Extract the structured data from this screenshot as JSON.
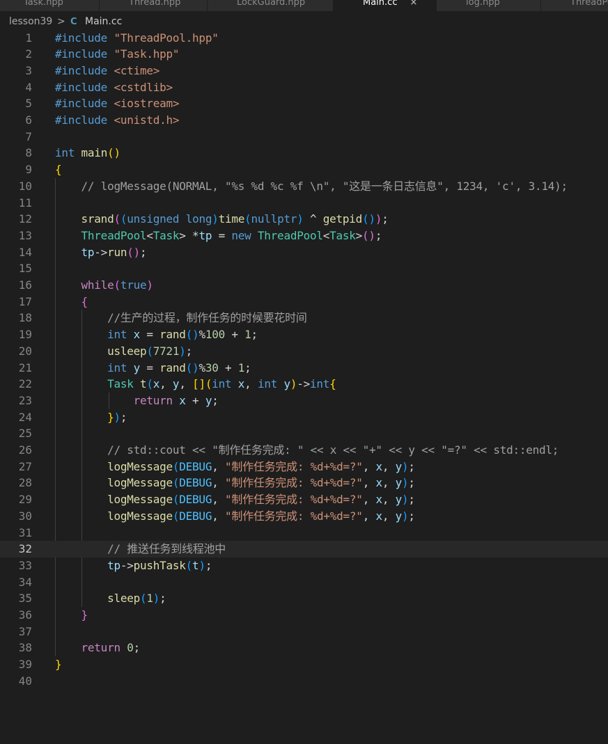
{
  "tabs": [
    {
      "label": "Task.hpp",
      "active": false
    },
    {
      "label": "Thread.hpp",
      "active": false
    },
    {
      "label": "LockGuard.hpp",
      "active": false
    },
    {
      "label": "Main.cc",
      "active": true
    },
    {
      "label": "log.hpp",
      "active": false
    },
    {
      "label": "ThreadPool.hpp",
      "active": false
    }
  ],
  "breadcrumb": {
    "folder": "lesson39",
    "separator": ">",
    "file_icon": "C",
    "file": "Main.cc"
  },
  "editor": {
    "current_line": 32,
    "lines": [
      {
        "n": "1",
        "tokens": [
          [
            "#include",
            "kw"
          ],
          [
            " ",
            "plain"
          ],
          [
            "\"ThreadPool.hpp\"",
            "str"
          ]
        ]
      },
      {
        "n": "2",
        "tokens": [
          [
            "#include",
            "kw"
          ],
          [
            " ",
            "plain"
          ],
          [
            "\"Task.hpp\"",
            "str"
          ]
        ]
      },
      {
        "n": "3",
        "tokens": [
          [
            "#include",
            "kw"
          ],
          [
            " ",
            "plain"
          ],
          [
            "<ctime>",
            "str"
          ]
        ]
      },
      {
        "n": "4",
        "tokens": [
          [
            "#include",
            "kw"
          ],
          [
            " ",
            "plain"
          ],
          [
            "<cstdlib>",
            "str"
          ]
        ]
      },
      {
        "n": "5",
        "tokens": [
          [
            "#include",
            "kw"
          ],
          [
            " ",
            "plain"
          ],
          [
            "<iostream>",
            "str"
          ]
        ]
      },
      {
        "n": "6",
        "tokens": [
          [
            "#include",
            "kw"
          ],
          [
            " ",
            "plain"
          ],
          [
            "<unistd.h>",
            "str"
          ]
        ]
      },
      {
        "n": "7",
        "tokens": []
      },
      {
        "n": "8",
        "tokens": [
          [
            "int",
            "kw"
          ],
          [
            " ",
            "plain"
          ],
          [
            "main",
            "fn"
          ],
          [
            "()",
            "b1"
          ]
        ]
      },
      {
        "n": "9",
        "tokens": [
          [
            "{",
            "b1"
          ]
        ]
      },
      {
        "n": "10",
        "tokens": [
          [
            "    ",
            "plain"
          ],
          [
            "// logMessage(NORMAL, \"%s %d %c %f \\n\", \"这是一条日志信息\", 1234, 'c', 3.14);",
            "cmt-gray"
          ]
        ]
      },
      {
        "n": "11",
        "tokens": []
      },
      {
        "n": "12",
        "tokens": [
          [
            "    ",
            "plain"
          ],
          [
            "srand",
            "fn"
          ],
          [
            "(",
            "b2"
          ],
          [
            "(",
            "b3"
          ],
          [
            "unsigned",
            "kw"
          ],
          [
            " ",
            "plain"
          ],
          [
            "long",
            "kw"
          ],
          [
            ")",
            "b3"
          ],
          [
            "time",
            "fn"
          ],
          [
            "(",
            "b3"
          ],
          [
            "nullptr",
            "kw"
          ],
          [
            ")",
            "b3"
          ],
          [
            " ^ ",
            "plain"
          ],
          [
            "getpid",
            "fn"
          ],
          [
            "()",
            "b3"
          ],
          [
            ")",
            "b2"
          ],
          [
            ";",
            "plain"
          ]
        ]
      },
      {
        "n": "13",
        "tokens": [
          [
            "    ",
            "plain"
          ],
          [
            "ThreadPool",
            "type"
          ],
          [
            "<",
            "plain"
          ],
          [
            "Task",
            "type"
          ],
          [
            "> *",
            "plain"
          ],
          [
            "tp",
            "var"
          ],
          [
            " = ",
            "plain"
          ],
          [
            "new",
            "kw"
          ],
          [
            " ",
            "plain"
          ],
          [
            "ThreadPool",
            "type"
          ],
          [
            "<",
            "plain"
          ],
          [
            "Task",
            "type"
          ],
          [
            ">",
            "plain"
          ],
          [
            "()",
            "b2"
          ],
          [
            ";",
            "plain"
          ]
        ]
      },
      {
        "n": "14",
        "tokens": [
          [
            "    ",
            "plain"
          ],
          [
            "tp",
            "var"
          ],
          [
            "->",
            "plain"
          ],
          [
            "run",
            "fn"
          ],
          [
            "()",
            "b2"
          ],
          [
            ";",
            "plain"
          ]
        ]
      },
      {
        "n": "15",
        "tokens": []
      },
      {
        "n": "16",
        "tokens": [
          [
            "    ",
            "plain"
          ],
          [
            "while",
            "ctrl"
          ],
          [
            "(",
            "b2"
          ],
          [
            "true",
            "kw"
          ],
          [
            ")",
            "b2"
          ]
        ]
      },
      {
        "n": "17",
        "tokens": [
          [
            "    ",
            "plain"
          ],
          [
            "{",
            "b2"
          ]
        ]
      },
      {
        "n": "18",
        "tokens": [
          [
            "        ",
            "plain"
          ],
          [
            "//生产的过程，制作任务的时候要花时间",
            "cmt-gray"
          ]
        ]
      },
      {
        "n": "19",
        "tokens": [
          [
            "        ",
            "plain"
          ],
          [
            "int",
            "kw"
          ],
          [
            " ",
            "plain"
          ],
          [
            "x",
            "var"
          ],
          [
            " = ",
            "plain"
          ],
          [
            "rand",
            "fn"
          ],
          [
            "()",
            "b3"
          ],
          [
            "%",
            "plain"
          ],
          [
            "100",
            "num"
          ],
          [
            " + ",
            "plain"
          ],
          [
            "1",
            "num"
          ],
          [
            ";",
            "plain"
          ]
        ]
      },
      {
        "n": "20",
        "tokens": [
          [
            "        ",
            "plain"
          ],
          [
            "usleep",
            "fn"
          ],
          [
            "(",
            "b3"
          ],
          [
            "7721",
            "num"
          ],
          [
            ")",
            "b3"
          ],
          [
            ";",
            "plain"
          ]
        ]
      },
      {
        "n": "21",
        "tokens": [
          [
            "        ",
            "plain"
          ],
          [
            "int",
            "kw"
          ],
          [
            " ",
            "plain"
          ],
          [
            "y",
            "var"
          ],
          [
            " = ",
            "plain"
          ],
          [
            "rand",
            "fn"
          ],
          [
            "()",
            "b3"
          ],
          [
            "%",
            "plain"
          ],
          [
            "30",
            "num"
          ],
          [
            " + ",
            "plain"
          ],
          [
            "1",
            "num"
          ],
          [
            ";",
            "plain"
          ]
        ]
      },
      {
        "n": "22",
        "tokens": [
          [
            "        ",
            "plain"
          ],
          [
            "Task",
            "type"
          ],
          [
            " ",
            "plain"
          ],
          [
            "t",
            "fn"
          ],
          [
            "(",
            "b3"
          ],
          [
            "x",
            "var"
          ],
          [
            ", ",
            "plain"
          ],
          [
            "y",
            "var"
          ],
          [
            ", ",
            "plain"
          ],
          [
            "[]",
            "b1"
          ],
          [
            "(",
            "b1"
          ],
          [
            "int",
            "kw"
          ],
          [
            " ",
            "plain"
          ],
          [
            "x",
            "var"
          ],
          [
            ", ",
            "plain"
          ],
          [
            "int",
            "kw"
          ],
          [
            " ",
            "plain"
          ],
          [
            "y",
            "var"
          ],
          [
            ")",
            "b1"
          ],
          [
            "->",
            "plain"
          ],
          [
            "int",
            "kw"
          ],
          [
            "{",
            "b1"
          ]
        ]
      },
      {
        "n": "23",
        "tokens": [
          [
            "            ",
            "plain"
          ],
          [
            "return",
            "ctrl"
          ],
          [
            " ",
            "plain"
          ],
          [
            "x",
            "var"
          ],
          [
            " + ",
            "plain"
          ],
          [
            "y",
            "var"
          ],
          [
            ";",
            "plain"
          ]
        ]
      },
      {
        "n": "24",
        "tokens": [
          [
            "        ",
            "plain"
          ],
          [
            "}",
            "b1"
          ],
          [
            ")",
            "b3"
          ],
          [
            ";",
            "plain"
          ]
        ]
      },
      {
        "n": "25",
        "tokens": []
      },
      {
        "n": "26",
        "tokens": [
          [
            "        ",
            "plain"
          ],
          [
            "// std::cout << \"制作任务完成: \" << x << \"+\" << y << \"=?\" << std::endl;",
            "cmt-gray"
          ]
        ]
      },
      {
        "n": "27",
        "tokens": [
          [
            "        ",
            "plain"
          ],
          [
            "logMessage",
            "fn"
          ],
          [
            "(",
            "b3"
          ],
          [
            "DEBUG",
            "enum"
          ],
          [
            ", ",
            "plain"
          ],
          [
            "\"制作任务完成: %d+%d=?\"",
            "str"
          ],
          [
            ", ",
            "plain"
          ],
          [
            "x",
            "var"
          ],
          [
            ", ",
            "plain"
          ],
          [
            "y",
            "var"
          ],
          [
            ")",
            "b3"
          ],
          [
            ";",
            "plain"
          ]
        ]
      },
      {
        "n": "28",
        "tokens": [
          [
            "        ",
            "plain"
          ],
          [
            "logMessage",
            "fn"
          ],
          [
            "(",
            "b3"
          ],
          [
            "DEBUG",
            "enum"
          ],
          [
            ", ",
            "plain"
          ],
          [
            "\"制作任务完成: %d+%d=?\"",
            "str"
          ],
          [
            ", ",
            "plain"
          ],
          [
            "x",
            "var"
          ],
          [
            ", ",
            "plain"
          ],
          [
            "y",
            "var"
          ],
          [
            ")",
            "b3"
          ],
          [
            ";",
            "plain"
          ]
        ]
      },
      {
        "n": "29",
        "tokens": [
          [
            "        ",
            "plain"
          ],
          [
            "logMessage",
            "fn"
          ],
          [
            "(",
            "b3"
          ],
          [
            "DEBUG",
            "enum"
          ],
          [
            ", ",
            "plain"
          ],
          [
            "\"制作任务完成: %d+%d=?\"",
            "str"
          ],
          [
            ", ",
            "plain"
          ],
          [
            "x",
            "var"
          ],
          [
            ", ",
            "plain"
          ],
          [
            "y",
            "var"
          ],
          [
            ")",
            "b3"
          ],
          [
            ";",
            "plain"
          ]
        ]
      },
      {
        "n": "30",
        "tokens": [
          [
            "        ",
            "plain"
          ],
          [
            "logMessage",
            "fn"
          ],
          [
            "(",
            "b3"
          ],
          [
            "DEBUG",
            "enum"
          ],
          [
            ", ",
            "plain"
          ],
          [
            "\"制作任务完成: %d+%d=?\"",
            "str"
          ],
          [
            ", ",
            "plain"
          ],
          [
            "x",
            "var"
          ],
          [
            ", ",
            "plain"
          ],
          [
            "y",
            "var"
          ],
          [
            ")",
            "b3"
          ],
          [
            ";",
            "plain"
          ]
        ]
      },
      {
        "n": "31",
        "tokens": []
      },
      {
        "n": "32",
        "tokens": [
          [
            "        ",
            "plain"
          ],
          [
            "// 推送任务到线程池中",
            "cmt-gray"
          ]
        ]
      },
      {
        "n": "33",
        "tokens": [
          [
            "        ",
            "plain"
          ],
          [
            "tp",
            "var"
          ],
          [
            "->",
            "plain"
          ],
          [
            "pushTask",
            "fn"
          ],
          [
            "(",
            "b3"
          ],
          [
            "t",
            "var"
          ],
          [
            ")",
            "b3"
          ],
          [
            ";",
            "plain"
          ]
        ]
      },
      {
        "n": "34",
        "tokens": []
      },
      {
        "n": "35",
        "tokens": [
          [
            "        ",
            "plain"
          ],
          [
            "sleep",
            "fn"
          ],
          [
            "(",
            "b3"
          ],
          [
            "1",
            "num"
          ],
          [
            ")",
            "b3"
          ],
          [
            ";",
            "plain"
          ]
        ]
      },
      {
        "n": "36",
        "tokens": [
          [
            "    ",
            "plain"
          ],
          [
            "}",
            "b2"
          ]
        ]
      },
      {
        "n": "37",
        "tokens": []
      },
      {
        "n": "38",
        "tokens": [
          [
            "    ",
            "plain"
          ],
          [
            "return",
            "ctrl"
          ],
          [
            " ",
            "plain"
          ],
          [
            "0",
            "num"
          ],
          [
            ";",
            "plain"
          ]
        ]
      },
      {
        "n": "39",
        "tokens": [
          [
            "}",
            "b1"
          ]
        ]
      },
      {
        "n": "40",
        "tokens": []
      }
    ]
  }
}
